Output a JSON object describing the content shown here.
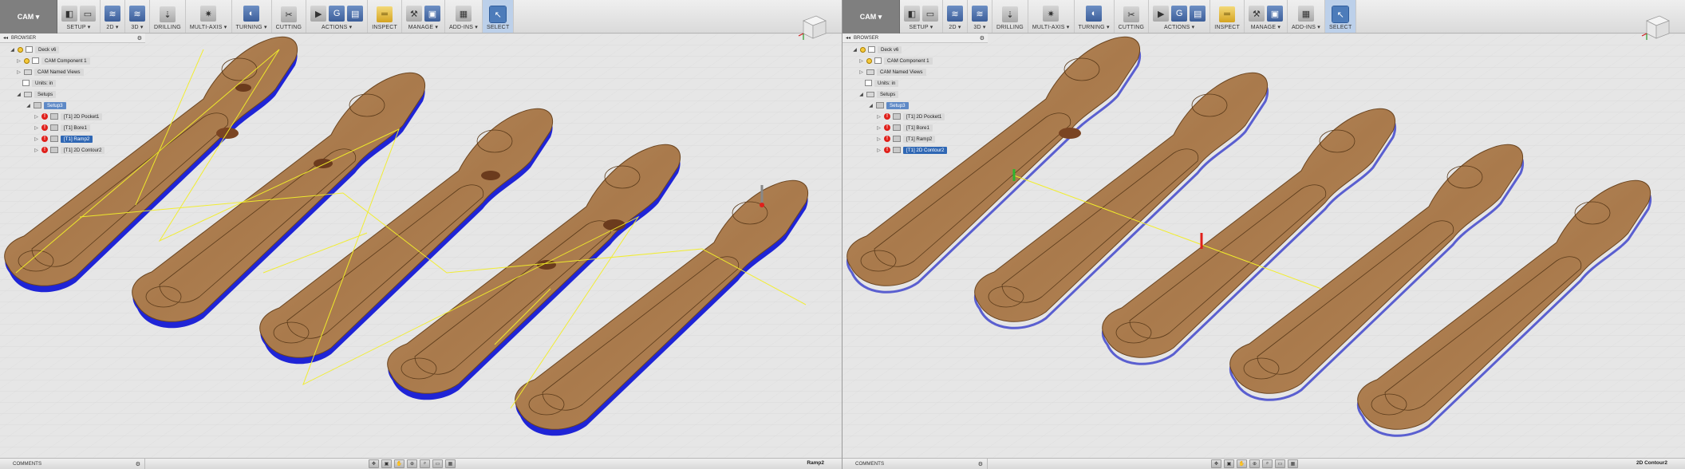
{
  "toolbar": {
    "workspace_label": "CAM ▾",
    "groups": [
      {
        "label": "SETUP ▾"
      },
      {
        "label": "2D ▾"
      },
      {
        "label": "3D ▾"
      },
      {
        "label": "DRILLING"
      },
      {
        "label": "MULTI-AXIS ▾"
      },
      {
        "label": "TURNING ▾"
      },
      {
        "label": "CUTTING"
      },
      {
        "label": "ACTIONS ▾"
      },
      {
        "label": "INSPECT"
      },
      {
        "label": "MANAGE ▾"
      },
      {
        "label": "ADD-INS ▾"
      },
      {
        "label": "SELECT"
      }
    ]
  },
  "browser": {
    "title": "BROWSER"
  },
  "tree": {
    "root": "Deck v6",
    "component": "CAM Component 1",
    "named_views": "CAM Named Views",
    "units": "Units: in",
    "setups": "Setups",
    "setup": "Setup3",
    "ops": [
      "[T1] 2D Pocket1",
      "[T1] Bore1",
      "[T1] Ramp2",
      "[T1] 2D Contour2"
    ]
  },
  "comments": {
    "label": "COMMENTS"
  },
  "viewports": [
    {
      "selected_op": "Ramp2",
      "toolpath_color": "#1f24d6"
    },
    {
      "selected_op": "2D Contour2",
      "toolpath_color": "#5a5fd0"
    }
  ],
  "colors": {
    "wood": "#b0845a",
    "wood_edge": "#6b4520",
    "rapid": "#f2ee2a"
  }
}
